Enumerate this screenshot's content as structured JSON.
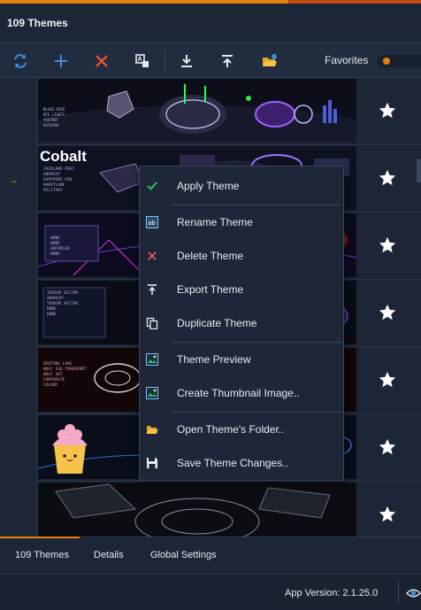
{
  "window": {
    "title": "109 Themes"
  },
  "toolbar": {
    "buttons": [
      {
        "name": "refresh-icon"
      },
      {
        "name": "add-icon"
      },
      {
        "name": "delete-icon"
      },
      {
        "name": "rename-icon"
      },
      {
        "name": "import-icon"
      },
      {
        "name": "export-icon"
      },
      {
        "name": "folder-icon"
      }
    ],
    "favorites_label": "Favorites"
  },
  "themes": {
    "rows": [
      {
        "title": "",
        "favorite": true
      },
      {
        "title": "Cobalt",
        "favorite": true,
        "selected": true
      },
      {
        "title": "",
        "favorite": true
      },
      {
        "title": "",
        "favorite": true
      },
      {
        "title": "",
        "favorite": true
      },
      {
        "title": "",
        "favorite": true
      },
      {
        "title": "",
        "favorite": true
      }
    ]
  },
  "context_menu": {
    "items": [
      {
        "label": "Apply Theme",
        "icon": "check-icon"
      },
      {
        "label": "Rename Theme",
        "icon": "rename-icon"
      },
      {
        "label": "Delete Theme",
        "icon": "close-icon"
      },
      {
        "label": "Export Theme",
        "icon": "export-icon"
      },
      {
        "label": "Duplicate Theme",
        "icon": "copy-icon"
      },
      {
        "label": "Theme Preview",
        "icon": "preview-icon"
      },
      {
        "label": "Create Thumbnail Image..",
        "icon": "image-icon"
      },
      {
        "label": "Open Theme's Folder..",
        "icon": "folder-open-icon"
      },
      {
        "label": "Save Theme Changes..",
        "icon": "save-icon"
      }
    ]
  },
  "tabs": [
    {
      "label": "109 Themes",
      "active": true
    },
    {
      "label": "Details"
    },
    {
      "label": "Global Settings"
    }
  ],
  "status": {
    "version": "App Version: 2.1.25.0"
  },
  "colors": {
    "accent": "#e8800c",
    "background": "#1d2636",
    "toolbar_blue": "#3d8fe0",
    "delete_red": "#e0532e",
    "check_green": "#3dbb5a"
  }
}
